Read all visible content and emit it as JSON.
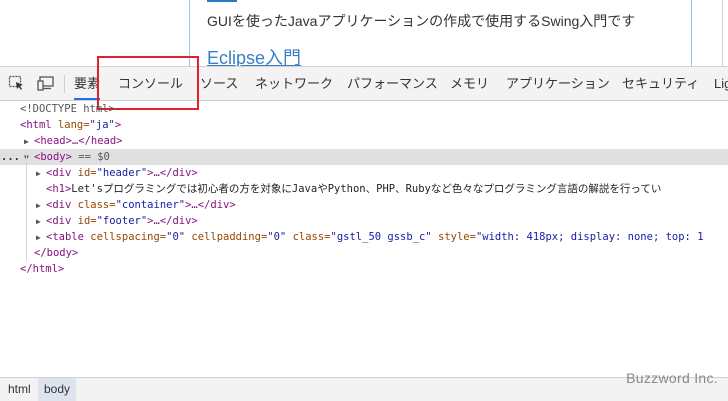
{
  "page": {
    "description": "GUIを使ったJavaアプリケーションの作成で使用するSwing入門です",
    "link": "Eclipse入門"
  },
  "toolbar": {
    "tabs": [
      {
        "label": "要素"
      },
      {
        "label": "コンソール"
      },
      {
        "label": "ソース"
      },
      {
        "label": "ネットワーク"
      },
      {
        "label": "パフォーマンス"
      },
      {
        "label": "メモリ"
      },
      {
        "label": "アプリケーション"
      },
      {
        "label": "セキュリティ"
      },
      {
        "label": "Lig"
      }
    ],
    "active_tab": "要素",
    "highlighted_tab": "コンソール"
  },
  "tree": {
    "doctype": "<!DOCTYPE html>",
    "html_open_tag": "<html",
    "html_lang_attr": " lang=",
    "html_lang_val": "\"ja\"",
    "tag_close": ">",
    "head": "<head>…</head>",
    "body_open": "<body>",
    "body_marker": " == $0",
    "div_open": "<div",
    "id_attr": " id=",
    "class_attr": " class=",
    "header_val": "\"header\"",
    "collapsed_div_close": ">…</div>",
    "h1_open": "<h1>",
    "h1_text": "Let'sプログラミングでは初心者の方を対象にJavaやPython、PHP、Rubyなど色々なプログラミング言語の解説を行ってい",
    "container_val": "\"container\"",
    "footer_val": "\"footer\"",
    "table_open": "<table",
    "cellspacing_attr": " cellspacing=",
    "cellspacing_val": "\"0\"",
    "cellpadding_attr": " cellpadding=",
    "cellpadding_val": "\"0\"",
    "table_class_val": "\"gstl_50 gssb_c\"",
    "style_attr": " style=",
    "style_val": "\"width: 418px; display: none; top: 1",
    "body_close": "</body>",
    "html_close": "</html>",
    "dots": "..."
  },
  "breadcrumbs": [
    {
      "label": "html"
    },
    {
      "label": "body"
    }
  ],
  "watermark": "Buzzword Inc.",
  "colors": {
    "tag": "#881280",
    "attr": "#994500",
    "value": "#1a1aa6",
    "highlight_box": "#e0202c",
    "active_tab": "#1a73e8"
  }
}
